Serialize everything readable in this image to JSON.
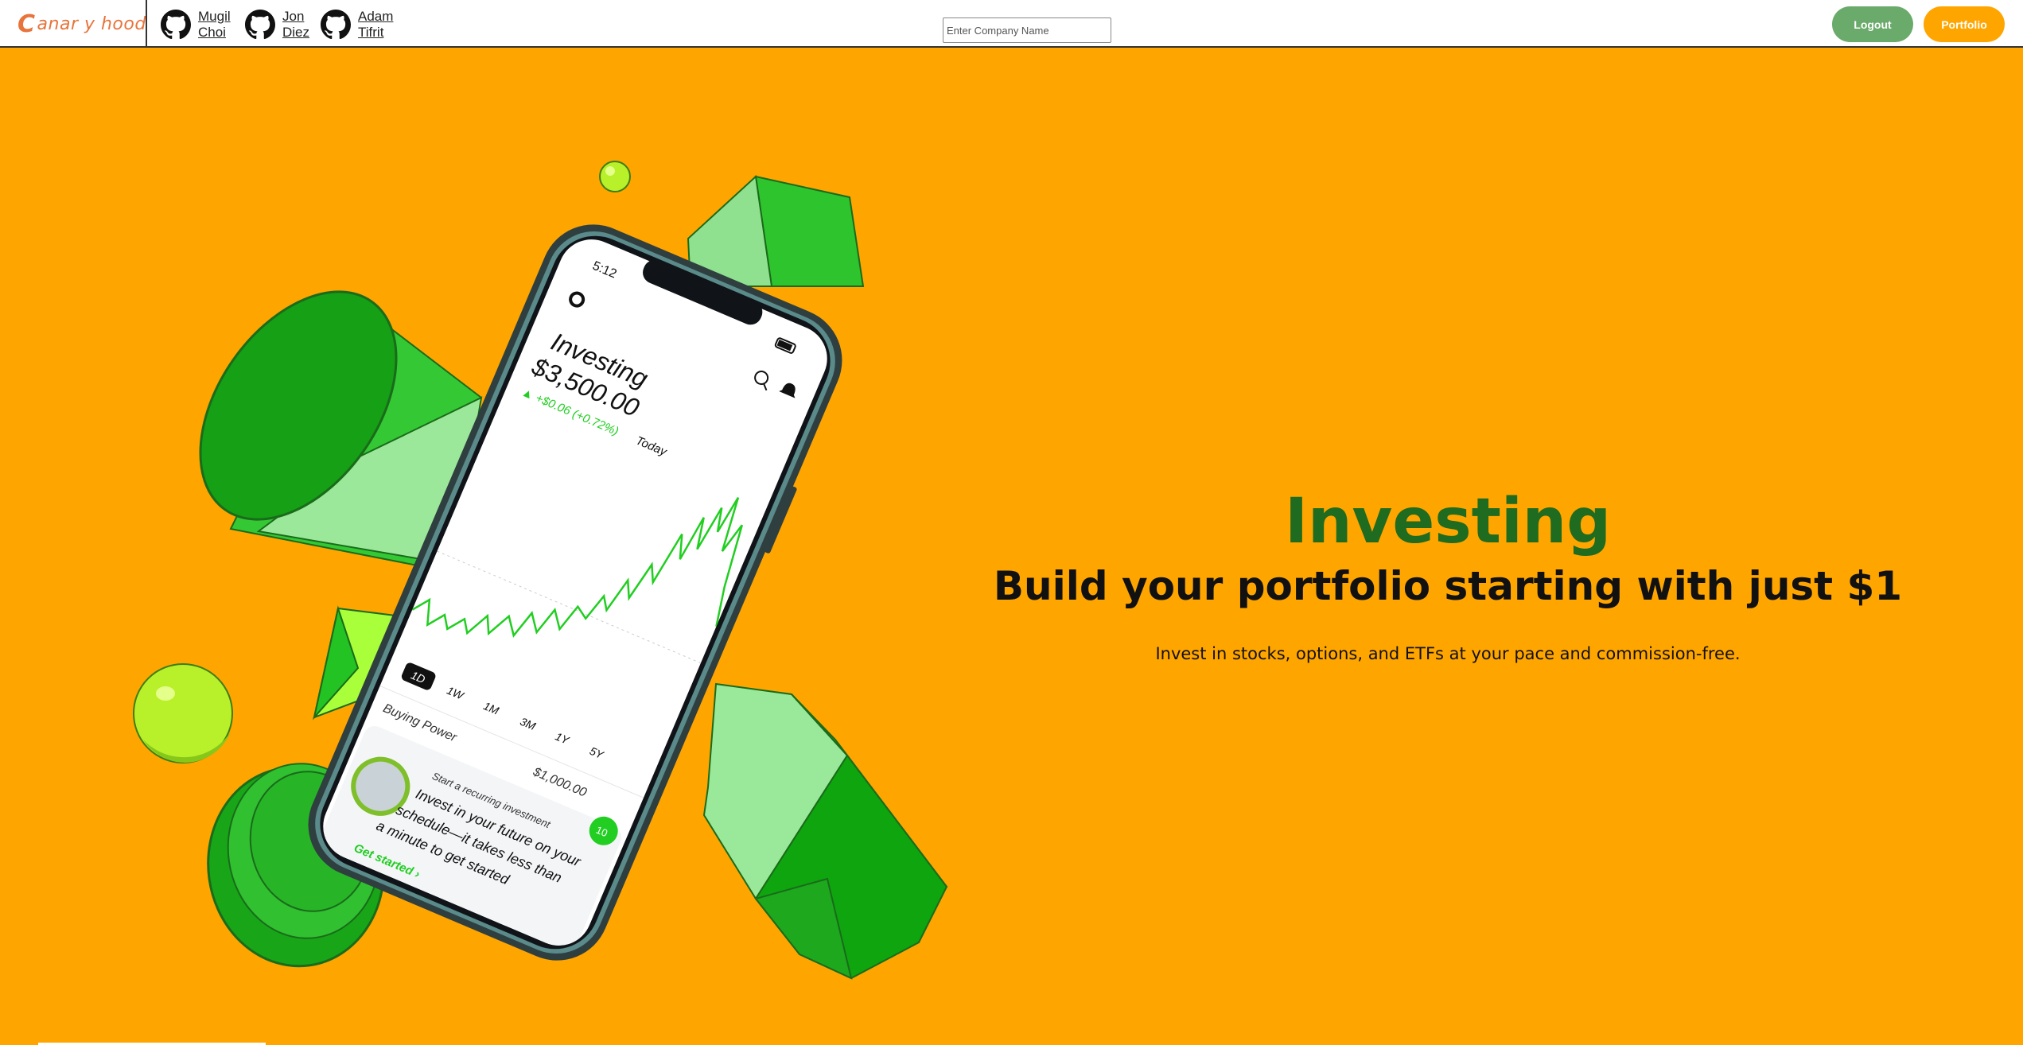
{
  "nav": {
    "logo_initial": "C",
    "logo_text": "anar y hood",
    "authors": [
      {
        "first": "Mugil",
        "last": "Choi"
      },
      {
        "first": "Jon",
        "last": "Diez"
      },
      {
        "first": "Adam",
        "last": "Tifrit"
      }
    ],
    "search_placeholder": "Enter Company Name",
    "logout_label": "Logout",
    "portfolio_label": "Portfolio"
  },
  "hero": {
    "title": "Investing",
    "subtitle": "Build your portfolio starting with just $1",
    "description": "Invest in stocks, options, and ETFs at your pace and commission-free."
  },
  "phone": {
    "time": "5:12",
    "header": "Investing",
    "value": "$3,500.00",
    "change": "▲ +$0.06 (+0.72%)",
    "change_period": "Today",
    "ranges": [
      "1D",
      "1W",
      "1M",
      "3M",
      "1Y",
      "5Y"
    ],
    "buying_power_label": "Buying Power",
    "buying_power_value": "$1,000.00",
    "badge": "10",
    "card_kicker": "Start a recurring investment",
    "card_line1": "Invest in your future on your",
    "card_line2": "schedule—it takes less than",
    "card_line3": "a minute to get started",
    "card_cta": "Get started  ›"
  },
  "colors": {
    "background": "#ffa500",
    "title_green": "#1f6b1f",
    "logout_bg": "#6aaa6a",
    "portfolio_bg": "#ffa500",
    "logo": "#e8743b"
  }
}
